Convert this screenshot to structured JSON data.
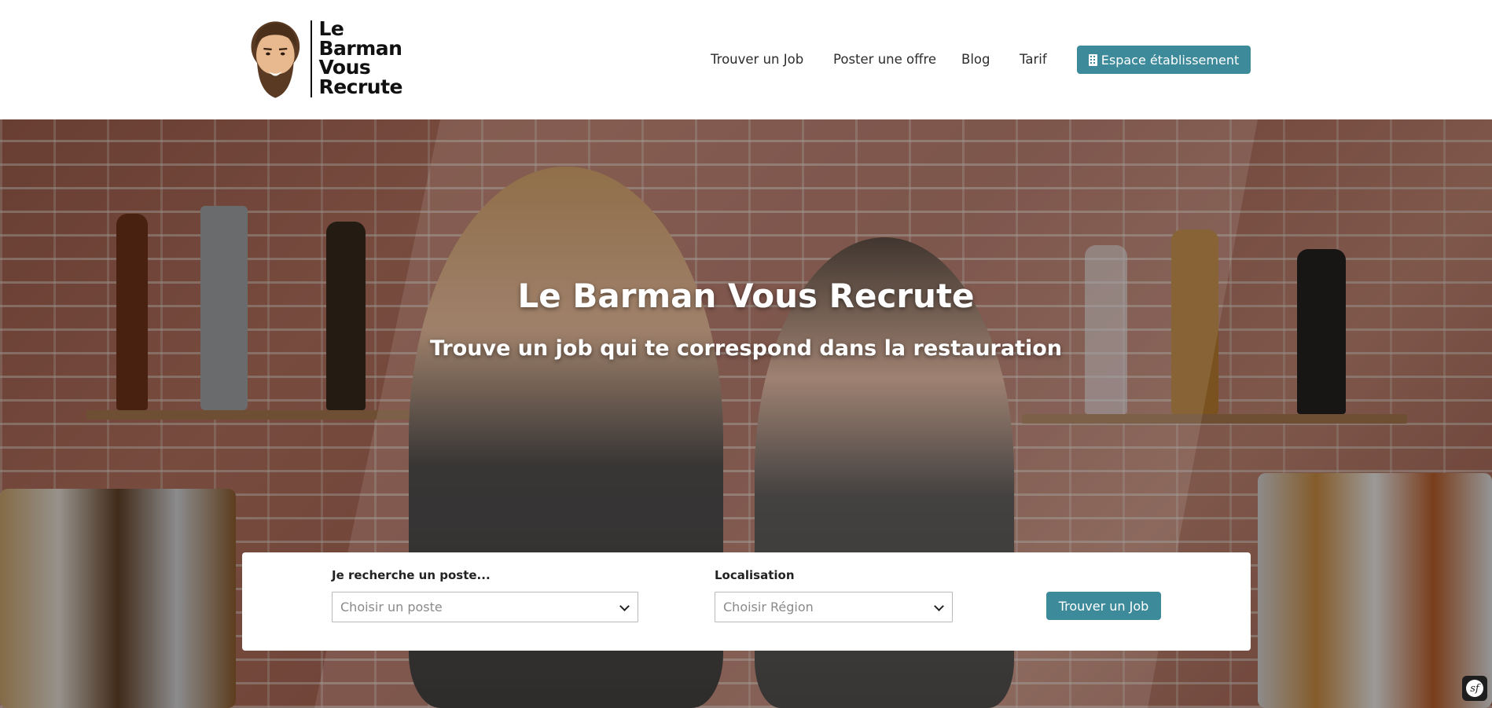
{
  "header": {
    "logo": {
      "line1": "Le",
      "line2": "Barman",
      "line3": "Vous",
      "line4": "Recrute"
    },
    "nav": [
      {
        "label": "Trouver un Job"
      },
      {
        "label": "Poster une offre"
      },
      {
        "label": "Blog"
      },
      {
        "label": "Tarif"
      }
    ],
    "cta": {
      "label": "Espace établissement",
      "icon": "building-icon"
    }
  },
  "hero": {
    "title": "Le Barman Vous Recrute",
    "subtitle": "Trouve un job qui te correspond dans la restauration"
  },
  "search": {
    "position_label": "Je recherche un poste...",
    "position_value": "Choisir un poste",
    "location_label": "Localisation",
    "location_value": "Choisir Région",
    "submit_label": "Trouver un Job"
  },
  "colors": {
    "accent": "#3d8a9b",
    "header_bg": "#ffffff",
    "hero_overlay": "#1a130f"
  }
}
